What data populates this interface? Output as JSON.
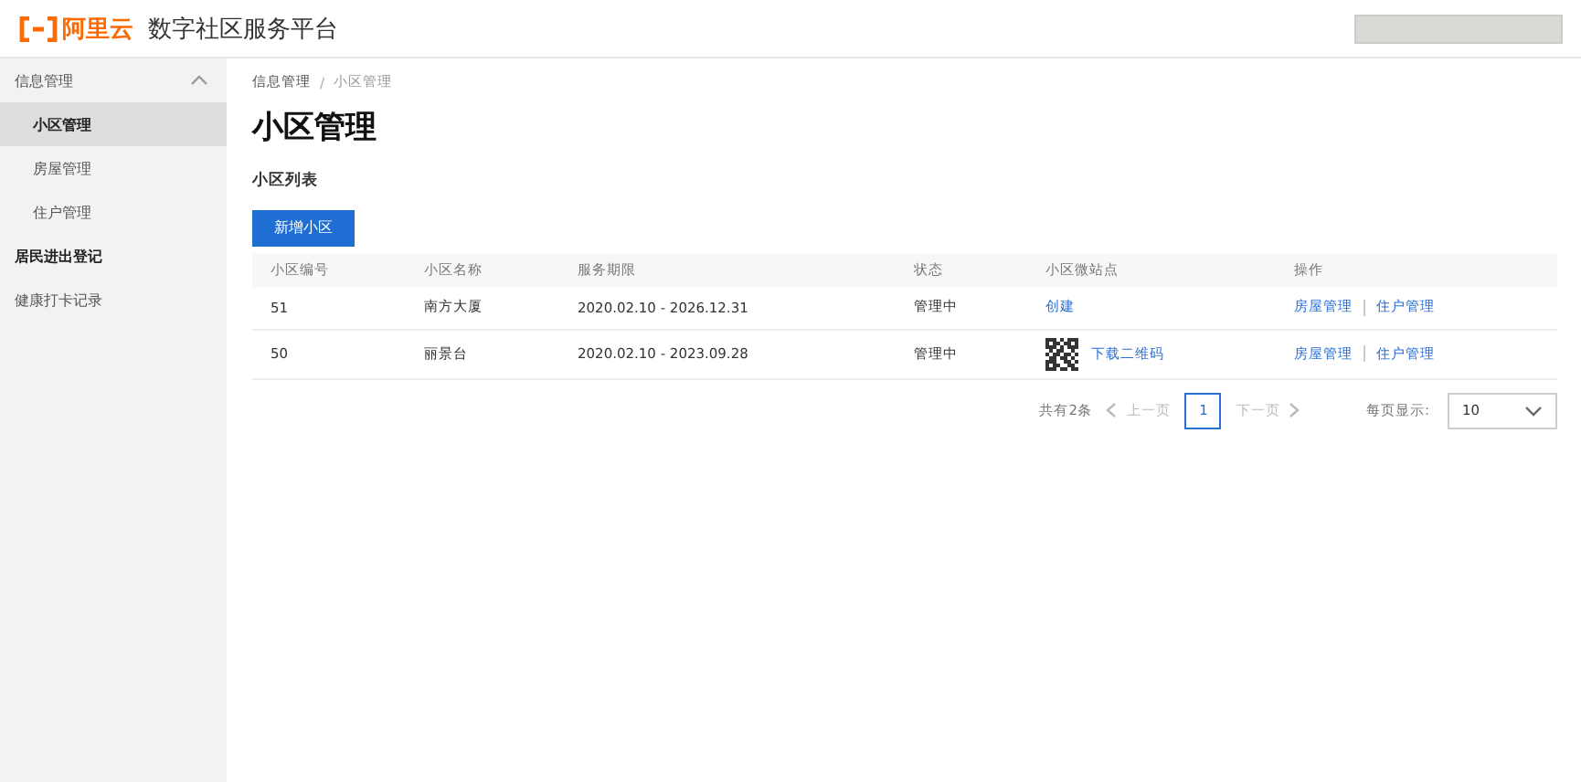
{
  "header": {
    "logo_text": "阿里云",
    "title": "数字社区服务平台"
  },
  "sidebar": {
    "items": [
      {
        "label": "信息管理",
        "expanded": true,
        "selected": false,
        "children": [
          {
            "label": "小区管理",
            "selected": true
          },
          {
            "label": "房屋管理",
            "selected": false
          },
          {
            "label": "住户管理",
            "selected": false
          }
        ]
      },
      {
        "label": "居民进出登记",
        "selected": false,
        "bold": true
      },
      {
        "label": "健康打卡记录",
        "selected": false,
        "bold": false
      }
    ]
  },
  "breadcrumb": [
    "信息管理",
    "小区管理"
  ],
  "breadcrumb_separator": "/",
  "page_title": "小区管理",
  "section_title": "小区列表",
  "add_button": "新增小区",
  "table": {
    "columns": [
      "小区编号",
      "小区名称",
      "服务期限",
      "状态",
      "小区微站点",
      "操作"
    ],
    "rows": [
      {
        "id": "51",
        "name": "南方大厦",
        "period": "2020.02.10 - 2026.12.31",
        "status": "管理中",
        "site": {
          "kind": "link",
          "text": "创建"
        },
        "actions": [
          "房屋管理",
          "住户管理"
        ]
      },
      {
        "id": "50",
        "name": "丽景台",
        "period": "2020.02.10 - 2023.09.28",
        "status": "管理中",
        "site": {
          "kind": "qr",
          "text": "下载二维码"
        },
        "actions": [
          "房屋管理",
          "住户管理"
        ]
      }
    ]
  },
  "pagination": {
    "total": "共有2条",
    "prev": {
      "label": "上一页",
      "disabled": true
    },
    "pages": [
      {
        "label": "1",
        "selected": true
      }
    ],
    "next": {
      "label": "下一页",
      "disabled": true
    },
    "page_size_label": "每页显示:",
    "page_size": "10"
  }
}
